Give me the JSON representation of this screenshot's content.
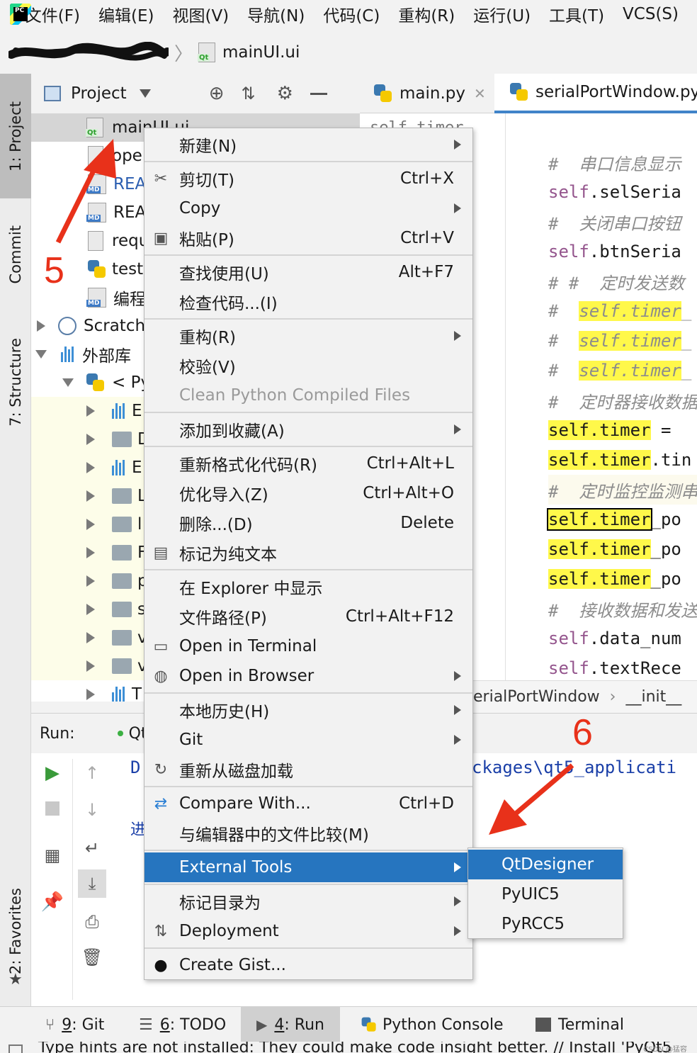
{
  "menubar": {
    "items": [
      "文件(F)",
      "编辑(E)",
      "视图(V)",
      "导航(N)",
      "代码(C)",
      "重构(R)",
      "运行(U)",
      "工具(T)",
      "VCS(S)"
    ]
  },
  "breadcrumb": {
    "file": "mainUI.ui"
  },
  "left_strip": {
    "project": "1: Project",
    "commit": "Commit",
    "structure": "7: Structure",
    "favorites": "2: Favorites"
  },
  "project_panel": {
    "title": "Project"
  },
  "tree": {
    "rows": [
      "mainUI.ui",
      "ope",
      "REA",
      "REA",
      "requ",
      "test",
      "编程",
      "Scratch",
      "外部库",
      "< Py",
      "E",
      "D",
      "E",
      "L",
      "l",
      "F",
      "p",
      "s",
      "v",
      "v",
      "T"
    ]
  },
  "editor": {
    "tabs": [
      "main.py",
      "serialPortWindow.py"
    ],
    "top_partial": "self.timer",
    "lines": [
      {
        "type": "comment",
        "text": "#  串口信息显示"
      },
      {
        "type": "code",
        "self": "self",
        "rest": ".selSeria"
      },
      {
        "type": "comment",
        "text": "#  关闭串口按钮"
      },
      {
        "type": "code",
        "self": "self",
        "rest": ".btnSeria"
      },
      {
        "type": "comment",
        "text": "# #  定时发送数"
      },
      {
        "type": "comment_hl",
        "prefix": "#  ",
        "hl": "self.timer",
        "rest": "_"
      },
      {
        "type": "comment_hl",
        "prefix": "#  ",
        "hl": "self.timer",
        "rest": "_"
      },
      {
        "type": "comment_hl",
        "prefix": "#  ",
        "hl": "self.timer",
        "rest": "_"
      },
      {
        "type": "comment",
        "text": "#  定时器接收数据"
      },
      {
        "type": "hl_code",
        "hl": "self.timer",
        "rest": " = "
      },
      {
        "type": "hl_code",
        "hl": "self.timer",
        "rest": ".tin"
      },
      {
        "type": "comment",
        "text": "#  定时监控监测串"
      },
      {
        "type": "boxed_code",
        "hl": "self.timer",
        "rest": "_po"
      },
      {
        "type": "hl_code",
        "hl": "self.timer",
        "rest": "_po"
      },
      {
        "type": "hl_code",
        "hl": "self.timer",
        "rest": "_po"
      },
      {
        "type": "comment",
        "text": "#  接收数据和发送"
      },
      {
        "type": "code",
        "self": "self",
        "rest": ".data_num"
      },
      {
        "type": "code",
        "self": "self",
        "rest": ".textRece"
      }
    ],
    "crumbs": [
      "erialPortWindow",
      "__init__"
    ]
  },
  "run_panel": {
    "label": "Run:",
    "config": "Qt",
    "output_1": "D",
    "output_path": "ckages\\qt5_applicati",
    "output_2": "进"
  },
  "context_menu": {
    "items": [
      {
        "label": "新建(N)",
        "shortcut": "",
        "submenu": true,
        "icon": ""
      },
      {
        "label": "剪切(T)",
        "shortcut": "Ctrl+X",
        "submenu": false,
        "icon": "scissors-icon"
      },
      {
        "label": "Copy",
        "shortcut": "",
        "submenu": true,
        "icon": ""
      },
      {
        "label": "粘贴(P)",
        "shortcut": "Ctrl+V",
        "submenu": false,
        "icon": "paste-icon"
      },
      {
        "label": "查找使用(U)",
        "shortcut": "Alt+F7",
        "submenu": false,
        "icon": ""
      },
      {
        "label": "检查代码...(I)",
        "shortcut": "",
        "submenu": false,
        "icon": ""
      },
      {
        "label": "重构(R)",
        "shortcut": "",
        "submenu": true,
        "icon": ""
      },
      {
        "label": "校验(V)",
        "shortcut": "",
        "submenu": false,
        "icon": ""
      },
      {
        "label": "Clean Python Compiled Files",
        "shortcut": "",
        "submenu": false,
        "icon": "",
        "disabled": true
      },
      {
        "label": "添加到收藏(A)",
        "shortcut": "",
        "submenu": true,
        "icon": ""
      },
      {
        "label": "重新格式化代码(R)",
        "shortcut": "Ctrl+Alt+L",
        "submenu": false,
        "icon": ""
      },
      {
        "label": "优化导入(Z)",
        "shortcut": "Ctrl+Alt+O",
        "submenu": false,
        "icon": ""
      },
      {
        "label": "删除...(D)",
        "shortcut": "Delete",
        "submenu": false,
        "icon": ""
      },
      {
        "label": "标记为纯文本",
        "shortcut": "",
        "submenu": false,
        "icon": "plain-text-icon"
      },
      {
        "label": "在 Explorer 中显示",
        "shortcut": "",
        "submenu": false,
        "icon": ""
      },
      {
        "label": "文件路径(P)",
        "shortcut": "Ctrl+Alt+F12",
        "submenu": false,
        "icon": ""
      },
      {
        "label": "Open in Terminal",
        "shortcut": "",
        "submenu": false,
        "icon": "terminal-icon"
      },
      {
        "label": "Open in Browser",
        "shortcut": "",
        "submenu": true,
        "icon": "globe-icon"
      },
      {
        "label": "本地历史(H)",
        "shortcut": "",
        "submenu": true,
        "icon": ""
      },
      {
        "label": "Git",
        "shortcut": "",
        "submenu": true,
        "icon": ""
      },
      {
        "label": "重新从磁盘加载",
        "shortcut": "",
        "submenu": false,
        "icon": "reload-icon"
      },
      {
        "label": "Compare With...",
        "shortcut": "Ctrl+D",
        "submenu": false,
        "icon": "compare-icon"
      },
      {
        "label": "与编辑器中的文件比较(M)",
        "shortcut": "",
        "submenu": false,
        "icon": ""
      },
      {
        "label": "External Tools",
        "shortcut": "",
        "submenu": true,
        "icon": "",
        "selected": true
      },
      {
        "label": "标记目录为",
        "shortcut": "",
        "submenu": true,
        "icon": ""
      },
      {
        "label": "Deployment",
        "shortcut": "",
        "submenu": true,
        "icon": "deploy-icon"
      },
      {
        "label": "Create Gist...",
        "shortcut": "",
        "submenu": false,
        "icon": "github-icon"
      }
    ]
  },
  "submenu": {
    "items": [
      "QtDesigner",
      "PyUIC5",
      "PyRCC5"
    ]
  },
  "annotations": {
    "step5": "5",
    "step6": "6",
    "color": "#e8311a"
  },
  "bottom_tabs": [
    {
      "num": "9",
      "label": ": Git"
    },
    {
      "num": "6",
      "label": ": TODO"
    },
    {
      "num": "4",
      "label": ": Run"
    },
    {
      "num": "",
      "label": "Python Console"
    },
    {
      "num": "",
      "label": "Terminal"
    }
  ],
  "status": {
    "text": "Type hints are not installed: They could make code insight better. // Install 'PyQt5",
    "watermark": "CSDN @猛容"
  }
}
